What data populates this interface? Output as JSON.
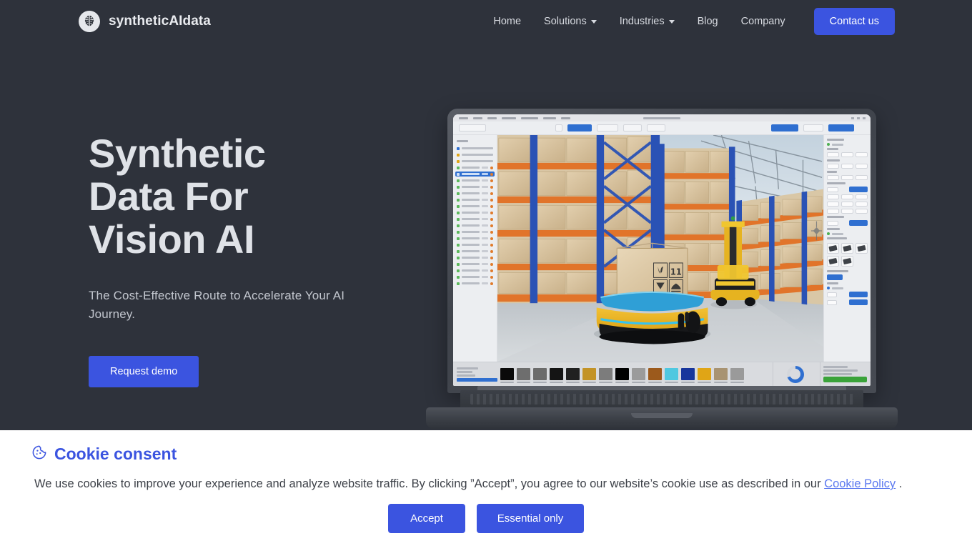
{
  "brand": {
    "name": "syntheticAIdata",
    "logo_icon": "brain-circuit-icon"
  },
  "nav": {
    "links": [
      {
        "label": "Home",
        "has_caret": false
      },
      {
        "label": "Solutions",
        "has_caret": true
      },
      {
        "label": "Industries",
        "has_caret": true
      },
      {
        "label": "Blog",
        "has_caret": false
      },
      {
        "label": "Company",
        "has_caret": false
      }
    ],
    "cta_label": "Contact us"
  },
  "hero": {
    "title_line1": "Synthetic",
    "title_line2": "Data For",
    "title_line3": "Vision AI",
    "subtitle": "The Cost-Effective Route to Accelerate Your AI Journey.",
    "button_label": "Request demo",
    "background_color": "#2e323b"
  },
  "laptop": {
    "alt": "Laptop displaying 3D synthetic-data generation app with a warehouse scene containing an AGV robot carrying a cardboard box and a forklift between blue and orange pallet racking",
    "app": {
      "swatch_colors": [
        "#0a0a0a",
        "#6e6e6e",
        "#6b6b6b",
        "#141414",
        "#202020",
        "#c39326",
        "#7c7c7c",
        "#000000",
        "#9b9b9b",
        "#9c5a1c",
        "#4fc8e0",
        "#17359c",
        "#e0a516",
        "#a89372",
        "#9a9a9a"
      ],
      "accent_color": "#2f6fd0",
      "render_button_color": "#3aa33a"
    }
  },
  "cookie": {
    "icon": "cookie-icon",
    "title": "Cookie consent",
    "text_before_link": "We use cookies to improve your experience and analyze website traffic. By clicking ”Accept”, you agree to our website’s cookie use as described in our",
    "link_label": "Cookie Policy",
    "text_after_link": ".",
    "accept_label": "Accept",
    "essential_label": "Essential only",
    "accent_color": "#3b54e0"
  }
}
